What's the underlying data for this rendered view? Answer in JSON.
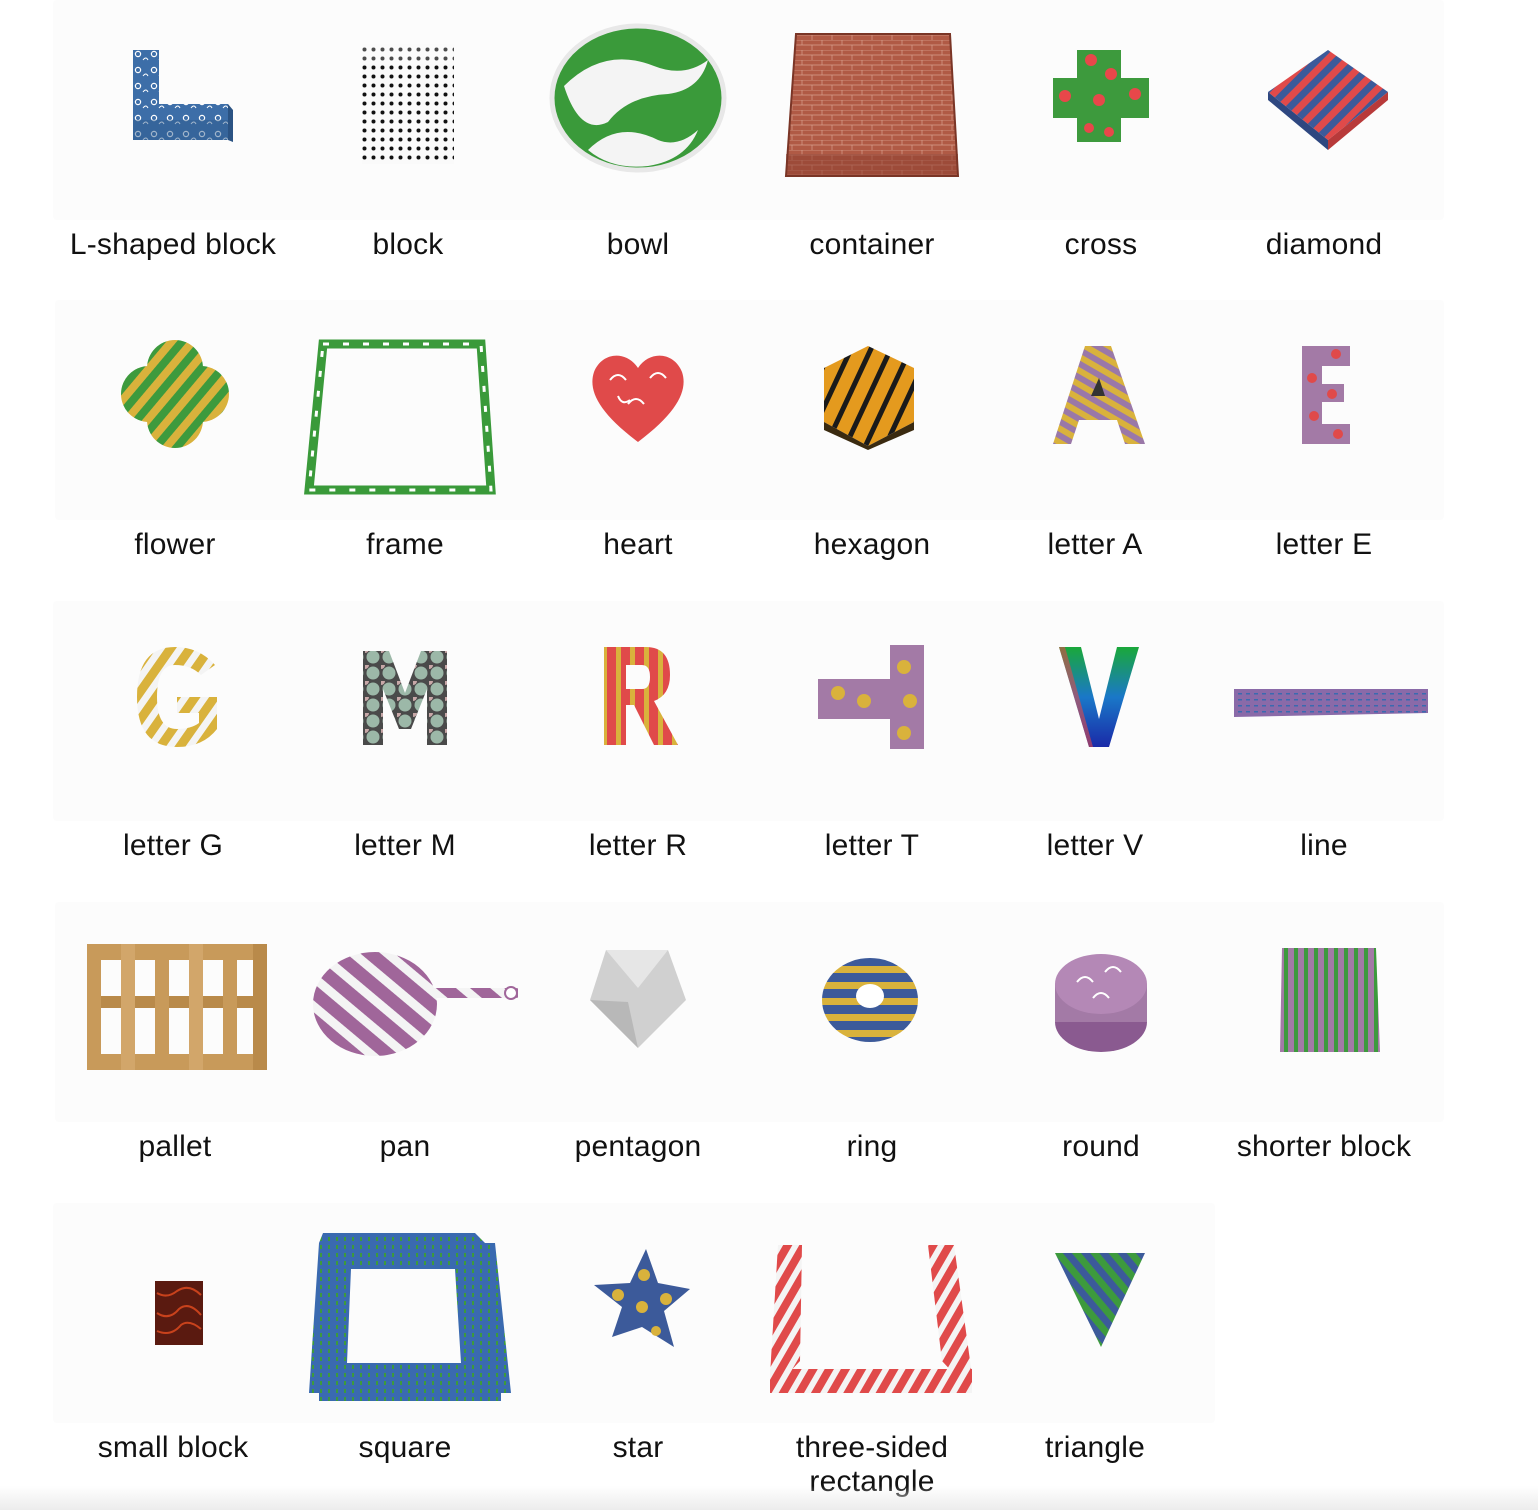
{
  "objects": [
    {
      "label": "L-shaped block",
      "icon": "l-shaped-block-icon",
      "colors": [
        "#3d6ea8",
        "#ffffff"
      ]
    },
    {
      "label": "block",
      "icon": "block-icon",
      "colors": [
        "#ffffff",
        "#111111"
      ]
    },
    {
      "label": "bowl",
      "icon": "bowl-icon",
      "colors": [
        "#3a9a3a",
        "#ffffff"
      ]
    },
    {
      "label": "container",
      "icon": "container-icon",
      "colors": [
        "#a5523e",
        "#c86f5a"
      ]
    },
    {
      "label": "cross",
      "icon": "cross-icon",
      "colors": [
        "#3d9a3d",
        "#e8474a"
      ]
    },
    {
      "label": "diamond",
      "icon": "diamond-icon",
      "colors": [
        "#3c5a9a",
        "#e04a4a"
      ]
    },
    {
      "label": "flower",
      "icon": "flower-icon",
      "colors": [
        "#3d9a3d",
        "#d9b23c"
      ]
    },
    {
      "label": "frame",
      "icon": "frame-icon",
      "colors": [
        "#3a9a3a",
        "#ffffff"
      ]
    },
    {
      "label": "heart",
      "icon": "heart-icon",
      "colors": [
        "#e04a4a",
        "#ffffff"
      ]
    },
    {
      "label": "hexagon",
      "icon": "hexagon-icon",
      "colors": [
        "#e49a1e",
        "#1a1a1a"
      ]
    },
    {
      "label": "letter A",
      "icon": "letter-a-icon",
      "colors": [
        "#9a78a8",
        "#d9b23c"
      ]
    },
    {
      "label": "letter E",
      "icon": "letter-e-icon",
      "colors": [
        "#a37aa6",
        "#e04a4a"
      ]
    },
    {
      "label": "letter G",
      "icon": "letter-g-icon",
      "colors": [
        "#d9b23c",
        "#ffffff"
      ]
    },
    {
      "label": "letter M",
      "icon": "letter-m-icon",
      "colors": [
        "#5a5a5a",
        "#b0c8b4"
      ]
    },
    {
      "label": "letter R",
      "icon": "letter-r-icon",
      "colors": [
        "#e04a4a",
        "#d9b23c"
      ]
    },
    {
      "label": "letter T",
      "icon": "letter-t-icon",
      "colors": [
        "#a37aa6",
        "#d9b23c"
      ]
    },
    {
      "label": "letter V",
      "icon": "letter-v-icon",
      "colors": [
        "#1a8a3a",
        "#1a3aa8"
      ]
    },
    {
      "label": "line",
      "icon": "line-icon",
      "colors": [
        "#8a6aa8",
        "#3a6ab0"
      ]
    },
    {
      "label": "pallet",
      "icon": "pallet-icon",
      "colors": [
        "#c89a5a",
        "#a87a40"
      ]
    },
    {
      "label": "pan",
      "icon": "pan-icon",
      "colors": [
        "#a0669a",
        "#ffffff"
      ]
    },
    {
      "label": "pentagon",
      "icon": "pentagon-icon",
      "colors": [
        "#d8d8d8",
        "#a8a8a8"
      ]
    },
    {
      "label": "ring",
      "icon": "ring-icon",
      "colors": [
        "#3c5a9a",
        "#d9b23c"
      ]
    },
    {
      "label": "round",
      "icon": "round-icon",
      "colors": [
        "#a37aa6",
        "#ffffff"
      ]
    },
    {
      "label": "shorter block",
      "icon": "shorter-block-icon",
      "colors": [
        "#3d9a3d",
        "#a37aa6"
      ]
    },
    {
      "label": "small block",
      "icon": "small-block-icon",
      "colors": [
        "#5a1a10",
        "#1a0a08"
      ]
    },
    {
      "label": "square",
      "icon": "square-icon",
      "colors": [
        "#3a6ab0",
        "#3d9a3d"
      ]
    },
    {
      "label": "star",
      "icon": "star-icon",
      "colors": [
        "#3c5a9a",
        "#d9b23c"
      ]
    },
    {
      "label": "three-sided rectangle",
      "icon": "three-sided-rectangle-icon",
      "colors": [
        "#e04a4a",
        "#ffffff"
      ]
    },
    {
      "label": "triangle",
      "icon": "triangle-icon",
      "colors": [
        "#3c5a9a",
        "#3d9a3d"
      ]
    }
  ]
}
